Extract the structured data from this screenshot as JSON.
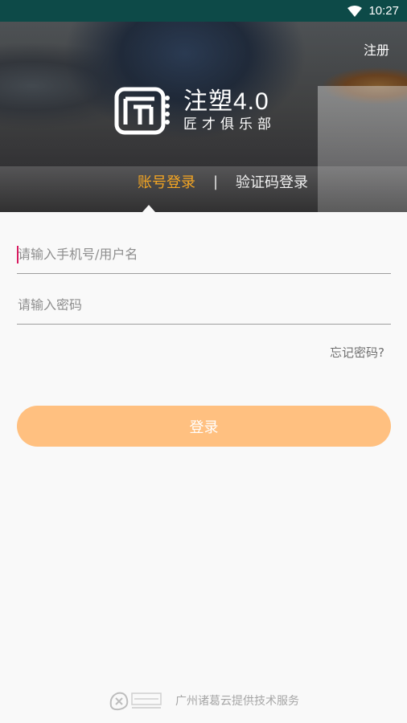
{
  "status_bar": {
    "time": "10:27"
  },
  "header": {
    "register_label": "注册",
    "logo": {
      "title": "注塑4.0",
      "subtitle": "匠才俱乐部"
    },
    "tabs": [
      {
        "label": "账号登录",
        "active": true
      },
      {
        "label": "验证码登录",
        "active": false
      }
    ],
    "tab_divider": "|"
  },
  "form": {
    "username_placeholder": "请输入手机号/用户名",
    "password_placeholder": "请输入密码",
    "forgot_label": "忘记密码?",
    "login_label": "登录"
  },
  "footer": {
    "text": "广州诸葛云提供技术服务"
  },
  "colors": {
    "status_bar_bg": "#0d4a48",
    "accent": "#f5a623",
    "login_button": "#ffc080",
    "caret": "#d81b60",
    "page_bg": "#f9f9f9"
  },
  "icons": [
    "wifi-icon",
    "battery-icon",
    "logo-mark-icon",
    "footer-logo-icon"
  ]
}
